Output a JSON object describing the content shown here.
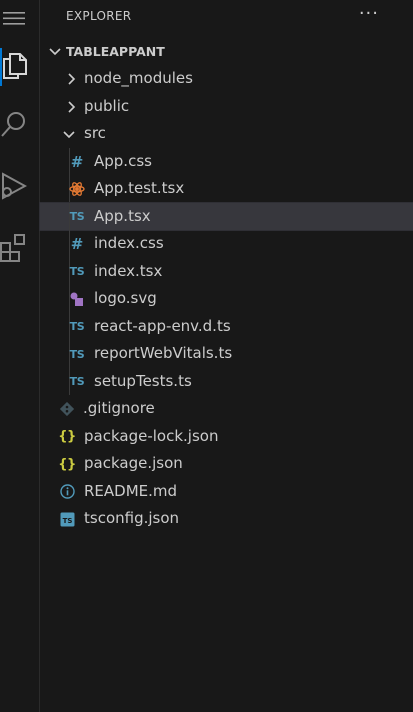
{
  "explorer": {
    "title": "EXPLORER",
    "more_actions": "···",
    "workspace": "TABLEAPPANT"
  },
  "activity_bar": {
    "items": [
      "files-icon",
      "search-icon",
      "run-debug-icon",
      "extensions-icon"
    ],
    "accent": "#0078d4"
  },
  "tree": [
    {
      "label": "node_modules",
      "kind": "folder",
      "expanded": false,
      "depth": 1
    },
    {
      "label": "public",
      "kind": "folder",
      "expanded": false,
      "depth": 1
    },
    {
      "label": "src",
      "kind": "folder",
      "expanded": true,
      "depth": 1
    },
    {
      "label": "App.css",
      "kind": "css",
      "depth": 2
    },
    {
      "label": "App.test.tsx",
      "kind": "react",
      "depth": 2
    },
    {
      "label": "App.tsx",
      "kind": "ts",
      "depth": 2,
      "selected": true
    },
    {
      "label": "index.css",
      "kind": "css",
      "depth": 2
    },
    {
      "label": "index.tsx",
      "kind": "ts",
      "depth": 2
    },
    {
      "label": "logo.svg",
      "kind": "svg",
      "depth": 2
    },
    {
      "label": "react-app-env.d.ts",
      "kind": "ts",
      "depth": 2
    },
    {
      "label": "reportWebVitals.ts",
      "kind": "ts",
      "depth": 2
    },
    {
      "label": "setupTests.ts",
      "kind": "ts",
      "depth": 2
    },
    {
      "label": ".gitignore",
      "kind": "git",
      "depth": 1
    },
    {
      "label": "package-lock.json",
      "kind": "json",
      "depth": 1
    },
    {
      "label": "package.json",
      "kind": "json",
      "depth": 1
    },
    {
      "label": "README.md",
      "kind": "info",
      "depth": 1
    },
    {
      "label": "tsconfig.json",
      "kind": "tsconfig",
      "depth": 1
    }
  ],
  "icon_glyphs": {
    "ts": "TS",
    "css": "#",
    "json": "{}"
  },
  "colors": {
    "background": "#181818",
    "selected_row": "#37373d",
    "ts_blue": "#519aba",
    "json_yellow": "#cbcb41",
    "react_orange": "#e37933",
    "svg_purple": "#a074c4"
  }
}
